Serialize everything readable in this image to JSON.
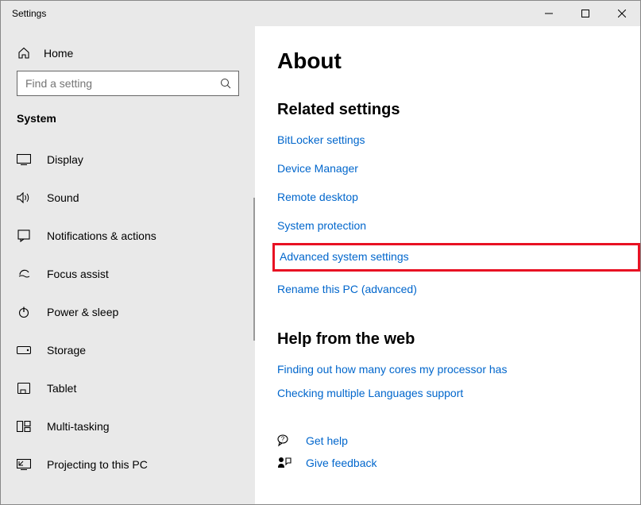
{
  "window": {
    "title": "Settings"
  },
  "sidebar": {
    "home": "Home",
    "search_placeholder": "Find a setting",
    "category": "System",
    "items": [
      {
        "label": "Display"
      },
      {
        "label": "Sound"
      },
      {
        "label": "Notifications & actions"
      },
      {
        "label": "Focus assist"
      },
      {
        "label": "Power & sleep"
      },
      {
        "label": "Storage"
      },
      {
        "label": "Tablet"
      },
      {
        "label": "Multi-tasking"
      },
      {
        "label": "Projecting to this PC"
      }
    ]
  },
  "main": {
    "title": "About",
    "related": {
      "heading": "Related settings",
      "links": [
        "BitLocker settings",
        "Device Manager",
        "Remote desktop",
        "System protection",
        "Advanced system settings",
        "Rename this PC (advanced)"
      ],
      "highlighted_index": 4
    },
    "help": {
      "heading": "Help from the web",
      "links": [
        "Finding out how many cores my processor has",
        "Checking multiple Languages support"
      ]
    },
    "footer": {
      "get_help": "Get help",
      "give_feedback": "Give feedback"
    }
  }
}
